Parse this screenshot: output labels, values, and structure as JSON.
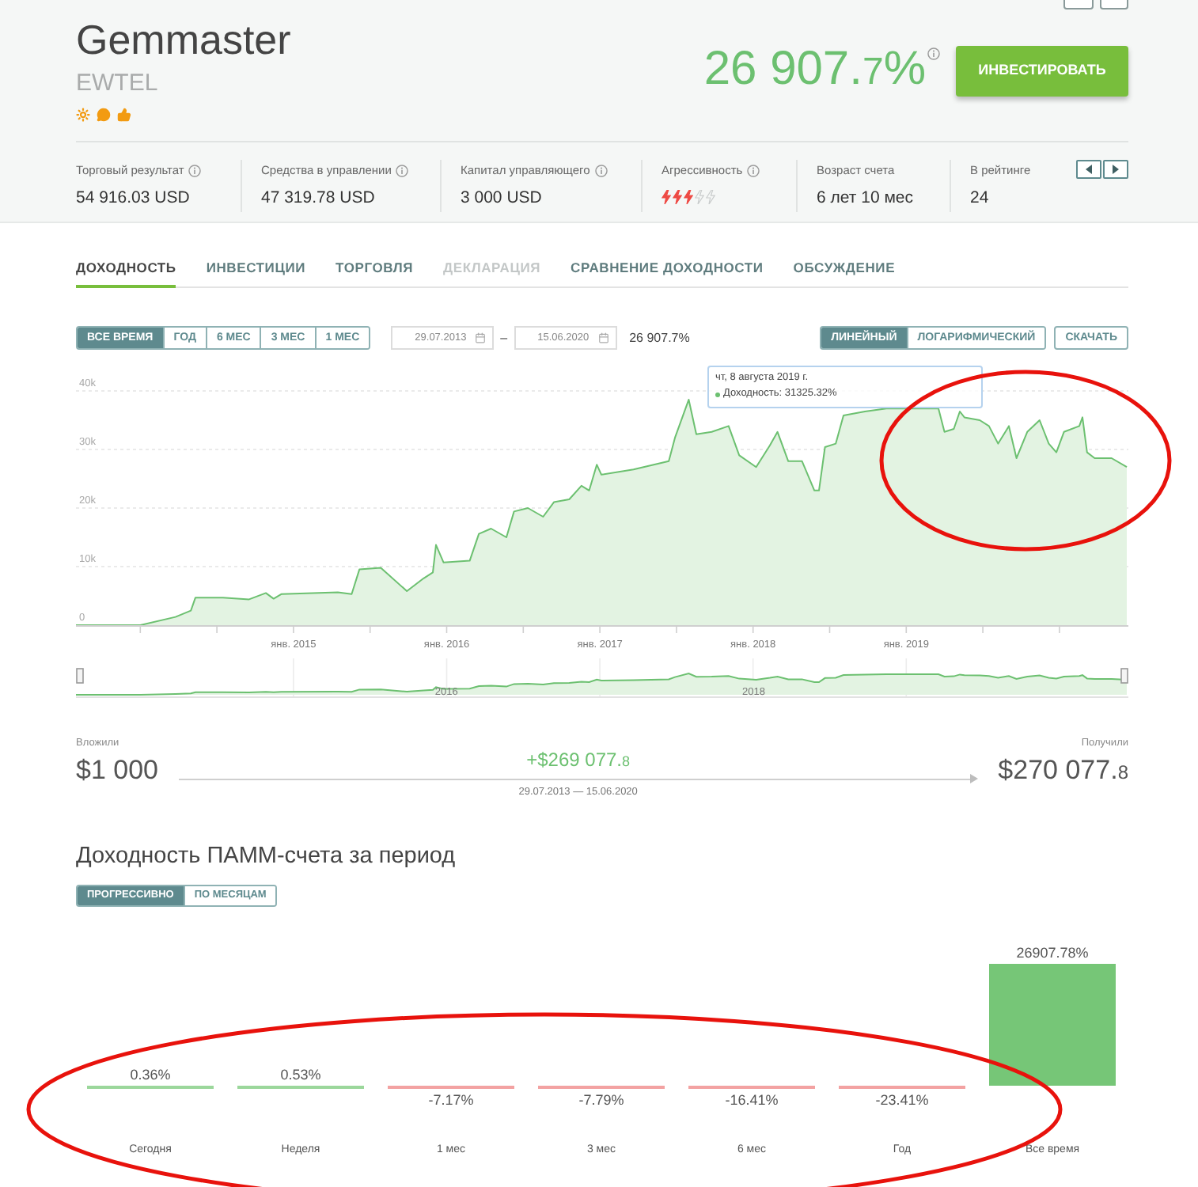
{
  "trader": {
    "name": "Gemmaster",
    "account": "EWTEL",
    "badges": [
      {
        "kind": "sun"
      },
      {
        "kind": "chat"
      },
      {
        "kind": "thumbs_up"
      }
    ]
  },
  "total_return": {
    "whole": "26 907.",
    "fraction": "7",
    "unit": "%",
    "info": true
  },
  "invest_button": "ИНВЕСТИРОВАТЬ",
  "stats": [
    {
      "kind": "text",
      "label": "Торговый результат",
      "info": true,
      "value": "54 916.03 USD"
    },
    {
      "kind": "text",
      "label": "Средства в управлении",
      "info": true,
      "value": "47 319.78 USD"
    },
    {
      "kind": "text",
      "label": "Капитал управляющего",
      "info": true,
      "value": "3 000 USD"
    },
    {
      "kind": "rating",
      "label": "Агрессивность",
      "info": true,
      "stars": 3
    },
    {
      "kind": "text",
      "label": "Возраст счета",
      "info": false,
      "value": "6 лет 10 мес"
    },
    {
      "kind": "text",
      "label": "В рейтинге",
      "info": false,
      "value": "24"
    }
  ],
  "tabs": [
    {
      "label": "ДОХОДНОСТЬ",
      "selected": true,
      "disabled": false
    },
    {
      "label": "ИНВЕСТИЦИИ",
      "selected": false,
      "disabled": false
    },
    {
      "label": "ТОРГОВЛЯ",
      "selected": false,
      "disabled": false
    },
    {
      "label": "ДЕКЛАРАЦИЯ",
      "selected": false,
      "disabled": true
    },
    {
      "label": "СРАВНЕНИЕ ДОХОДНОСТИ",
      "selected": false,
      "disabled": false
    },
    {
      "label": "ОБСУЖДЕНИЕ",
      "selected": false,
      "disabled": false
    }
  ],
  "periods": [
    {
      "label": "ВСЕ ВРЕМЯ",
      "selected": true
    },
    {
      "label": "ГОД",
      "selected": false
    },
    {
      "label": "6 МЕС",
      "selected": false
    },
    {
      "label": "3 МЕС",
      "selected": false
    },
    {
      "label": "1 МЕС",
      "selected": false
    }
  ],
  "date_range": {
    "from": "29.07.2013",
    "separator": "–",
    "to": "15.06.2020",
    "result": "26 907.7%"
  },
  "scales": [
    {
      "label": "ЛИНЕЙНЫЙ",
      "selected": true
    },
    {
      "label": "ЛОГАРИФМИЧЕСКИЙ",
      "selected": false
    }
  ],
  "download_button": "СКАЧАТЬ",
  "chart": {
    "tooltip": {
      "date": "чт, 8 августа 2019 г.",
      "text": "Доходность: 31325.32%"
    },
    "chart_data": {
      "type": "area",
      "grid": true,
      "x": [
        2013.58,
        2014.0,
        2014.23,
        2014.33,
        2014.36,
        2014.54,
        2014.71,
        2014.82,
        2014.87,
        2014.92,
        2015.29,
        2015.38,
        2015.43,
        2015.57,
        2015.74,
        2015.85,
        2015.91,
        2015.93,
        2015.98,
        2016.15,
        2016.21,
        2016.29,
        2016.39,
        2016.44,
        2016.53,
        2016.63,
        2016.7,
        2016.8,
        2016.88,
        2016.93,
        2016.98,
        2017.01,
        2017.22,
        2017.45,
        2017.49,
        2017.58,
        2017.63,
        2017.73,
        2017.84,
        2017.91,
        2018.02,
        2018.11,
        2018.16,
        2018.23,
        2018.32,
        2018.4,
        2018.43,
        2018.47,
        2018.54,
        2018.59,
        2018.73,
        2018.87,
        2019.21,
        2019.25,
        2019.31,
        2019.35,
        2019.38,
        2019.48,
        2019.54,
        2019.6,
        2019.67,
        2019.72,
        2019.79,
        2019.87,
        2019.93,
        2019.98,
        2020.03,
        2020.13,
        2020.15,
        2020.18,
        2020.23,
        2020.34,
        2020.44
      ],
      "series": [
        {
          "color": "#6cc070",
          "values": [
            0,
            0,
            1400,
            2500,
            4700,
            4700,
            4400,
            5500,
            4500,
            5300,
            5600,
            5300,
            9500,
            9800,
            5800,
            8000,
            9000,
            13700,
            10700,
            11000,
            15600,
            16500,
            15000,
            19400,
            20000,
            18500,
            21000,
            21500,
            23800,
            23000,
            27400,
            25700,
            26600,
            28000,
            32000,
            38500,
            32600,
            33000,
            34000,
            29000,
            27000,
            30700,
            33000,
            28000,
            28000,
            23000,
            23000,
            30400,
            31000,
            35800,
            36500,
            37000,
            37000,
            33000,
            33500,
            36500,
            35500,
            35000,
            34000,
            31000,
            34000,
            28500,
            33000,
            35000,
            31000,
            29500,
            33000,
            34000,
            35500,
            29500,
            28500,
            28500,
            27000
          ]
        }
      ],
      "xlim": [
        2013.58,
        2020.45
      ],
      "ylim": [
        0,
        40000
      ],
      "xticks": [
        {
          "value": 2015,
          "label": "янв. 2015"
        },
        {
          "value": 2016,
          "label": "янв. 2016"
        },
        {
          "value": 2017,
          "label": "янв. 2017"
        },
        {
          "value": 2018,
          "label": "янв. 2018"
        },
        {
          "value": 2019,
          "label": "янв. 2019"
        }
      ],
      "yticks": [
        {
          "value": 0,
          "label": "0"
        },
        {
          "value": 10000,
          "label": "10k"
        },
        {
          "value": 20000,
          "label": "20k"
        },
        {
          "value": 30000,
          "label": "30k"
        },
        {
          "value": 40000,
          "label": "40k"
        }
      ]
    }
  },
  "navigator": {
    "labels": [
      "2016",
      "2018"
    ]
  },
  "summary": {
    "invested_label": "Вложили",
    "invested": "$1 000",
    "profit": {
      "whole": "+$269 077.",
      "fraction": "8"
    },
    "period": "29.07.2013 — 15.06.2020",
    "received_label": "Получили",
    "received": {
      "whole": "$270 077.",
      "fraction": "8"
    }
  },
  "period_returns": {
    "title": "Доходность ПАММ-счета за период",
    "modes": [
      {
        "label": "ПРОГРЕССИВНО",
        "selected": true
      },
      {
        "label": "ПО МЕСЯЦАМ",
        "selected": false
      }
    ],
    "chart_data": {
      "type": "bar",
      "categories": [
        "Сегодня",
        "Неделя",
        "1 мес",
        "3 мес",
        "6 мес",
        "Год",
        "Все время"
      ],
      "values": [
        0.36,
        0.53,
        -7.17,
        -7.79,
        -16.41,
        -23.41,
        26907.78
      ],
      "value_labels": [
        "0.36%",
        "0.53%",
        "-7.17%",
        "-7.79%",
        "-16.41%",
        "-23.41%",
        "26907.78%"
      ]
    }
  },
  "annotations": [
    {
      "kind": "ellipse"
    },
    {
      "kind": "ellipse"
    }
  ]
}
